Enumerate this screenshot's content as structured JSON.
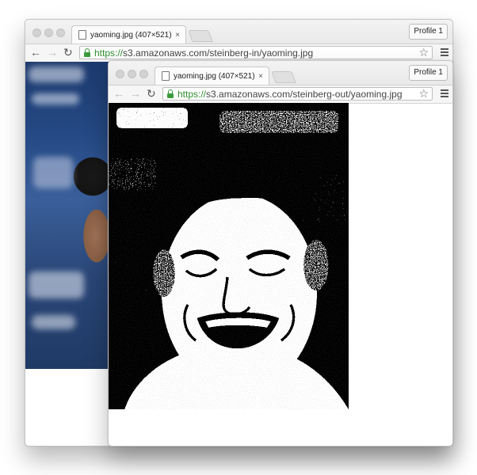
{
  "back_window": {
    "tab_title": "yaoming.jpg (407×521)",
    "close_glyph": "×",
    "profile_label": "Profile 1",
    "url_scheme": "https://",
    "url_rest": "s3.amazonaws.com/steinberg-in/yaoming.jpg",
    "image_kind": "color-photo"
  },
  "front_window": {
    "tab_title": "yaoming.jpg (407×521)",
    "close_glyph": "×",
    "profile_label": "Profile 1",
    "url_scheme": "https://",
    "url_rest": "s3.amazonaws.com/steinberg-out/yaoming.jpg",
    "image_kind": "dithered-black-and-white-photo"
  },
  "icons": {
    "back": "←",
    "forward": "→",
    "reload": "↻",
    "star": "☆",
    "menu": "hamburger-icon"
  },
  "colors": {
    "secure_green": "#2e8c2e",
    "chrome_frame": "#e9e9e9"
  }
}
